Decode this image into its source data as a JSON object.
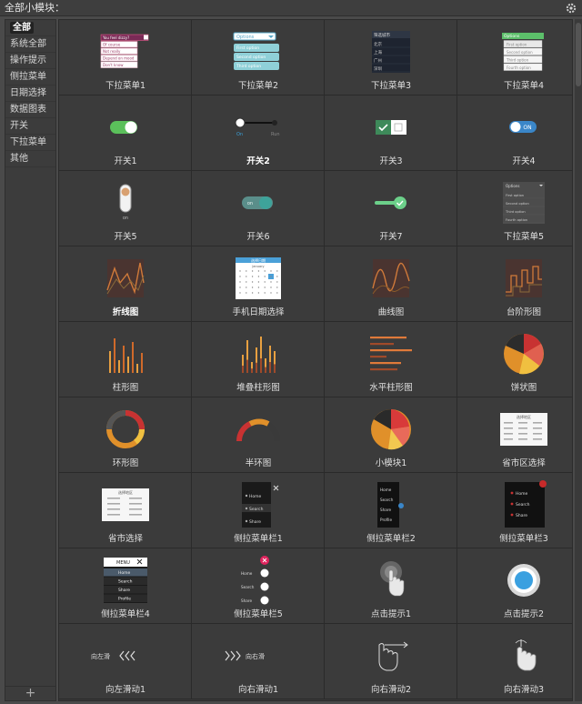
{
  "header": {
    "title": "全部小模块："
  },
  "sidebar": {
    "items": [
      {
        "label": "全部",
        "active": true
      },
      {
        "label": "系统全部"
      },
      {
        "label": "操作提示"
      },
      {
        "label": "侧拉菜单"
      },
      {
        "label": "日期选择"
      },
      {
        "label": "数据图表"
      },
      {
        "label": "开关"
      },
      {
        "label": "下拉菜单"
      },
      {
        "label": "其他"
      }
    ],
    "add_label": "+"
  },
  "modules": [
    {
      "label": "下拉菜单1",
      "icon": "dropdown1"
    },
    {
      "label": "下拉菜单2",
      "icon": "dropdown2"
    },
    {
      "label": "下拉菜单3",
      "icon": "dropdown3"
    },
    {
      "label": "下拉菜单4",
      "icon": "dropdown4"
    },
    {
      "label": "开关1",
      "icon": "switch1"
    },
    {
      "label": "开关2",
      "icon": "switch2",
      "bold": true
    },
    {
      "label": "开关3",
      "icon": "switch3"
    },
    {
      "label": "开关4",
      "icon": "switch4"
    },
    {
      "label": "开关5",
      "icon": "switch5"
    },
    {
      "label": "开关6",
      "icon": "switch6"
    },
    {
      "label": "开关7",
      "icon": "switch7"
    },
    {
      "label": "下拉菜单5",
      "icon": "dropdown5"
    },
    {
      "label": "折线图",
      "icon": "line-chart",
      "bold": true
    },
    {
      "label": "手机日期选择",
      "icon": "calendar"
    },
    {
      "label": "曲线图",
      "icon": "curve-chart"
    },
    {
      "label": "台阶形图",
      "icon": "step-chart"
    },
    {
      "label": "柱形图",
      "icon": "bar-chart"
    },
    {
      "label": "堆叠柱形图",
      "icon": "stacked-bar-chart"
    },
    {
      "label": "水平柱形图",
      "icon": "hbar-chart"
    },
    {
      "label": "饼状图",
      "icon": "pie-chart"
    },
    {
      "label": "环形图",
      "icon": "ring-chart"
    },
    {
      "label": "半环图",
      "icon": "half-ring-chart"
    },
    {
      "label": "小模块1",
      "icon": "pie-small"
    },
    {
      "label": "省市区选择",
      "icon": "region-picker"
    },
    {
      "label": "省市选择",
      "icon": "city-picker"
    },
    {
      "label": "侧拉菜单栏1",
      "icon": "side-menu1"
    },
    {
      "label": "侧拉菜单栏2",
      "icon": "side-menu2"
    },
    {
      "label": "侧拉菜单栏3",
      "icon": "side-menu3"
    },
    {
      "label": "侧拉菜单栏4",
      "icon": "side-menu4"
    },
    {
      "label": "侧拉菜单栏5",
      "icon": "side-menu5"
    },
    {
      "label": "点击提示1",
      "icon": "tap-hint1"
    },
    {
      "label": "点击提示2",
      "icon": "tap-hint2"
    },
    {
      "label": "向左滑动1",
      "icon": "swipe-left"
    },
    {
      "label": "向右滑动1",
      "icon": "swipe-right"
    },
    {
      "label": "向右滑动2",
      "icon": "swipe-right2"
    },
    {
      "label": "向右滑动3",
      "icon": "swipe-right3"
    }
  ],
  "thumb_text": {
    "dd1": [
      "You feel dizzy?",
      "Of course",
      "Not really",
      "Depend on mood",
      "Don't know"
    ],
    "dd2": [
      "Options",
      "First option",
      "Second option",
      "Third option"
    ],
    "dd3": [
      "筛选城市",
      "北京",
      "上海",
      "广州",
      "深圳"
    ],
    "dd4": [
      "Options",
      "First option",
      "Second option",
      "Third option",
      "Fourth option"
    ],
    "dd5": [
      "Options",
      "First option",
      "Second option",
      "Third option",
      "Fourth option"
    ],
    "sw2_left": "On",
    "sw2_right": "Run",
    "sw4": "ON",
    "sw5": "on",
    "sw6": "on",
    "calendar_header": "选择日期",
    "calendar_month": "January",
    "picker_title": "选择地区",
    "menu_items": [
      "Home",
      "Search",
      "Share",
      "Profile"
    ],
    "menu_title": "MENU",
    "swipe_left": "向左滑",
    "swipe_right": "向右滑"
  },
  "colors": {
    "accent": "#3aa0d8",
    "switch_green": "#5bc05b",
    "teal": "#3ea39a",
    "orange": "#e08a2a",
    "red": "#d23b3b",
    "pink": "#e0245e"
  }
}
